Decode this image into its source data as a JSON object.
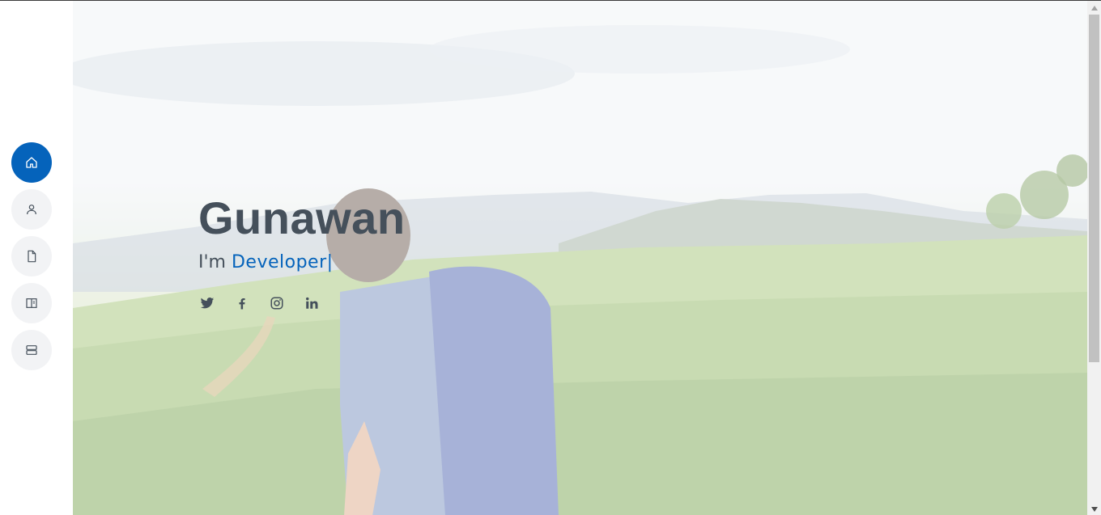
{
  "hero": {
    "name": "Gunawan",
    "intro_prefix": "I'm ",
    "typed_role": "Developer",
    "cursor": "|"
  },
  "socials": [
    {
      "icon": "twitter-icon"
    },
    {
      "icon": "facebook-icon"
    },
    {
      "icon": "instagram-icon"
    },
    {
      "icon": "linkedin-icon"
    }
  ],
  "nav": {
    "items": [
      {
        "icon": "home-icon",
        "active": true
      },
      {
        "icon": "user-icon",
        "active": false
      },
      {
        "icon": "file-icon",
        "active": false
      },
      {
        "icon": "book-icon",
        "active": false
      },
      {
        "icon": "server-icon",
        "active": false
      }
    ]
  },
  "colors": {
    "accent": "#0563bb",
    "heading": "#45505b",
    "nav_bg": "#f2f3f5"
  }
}
